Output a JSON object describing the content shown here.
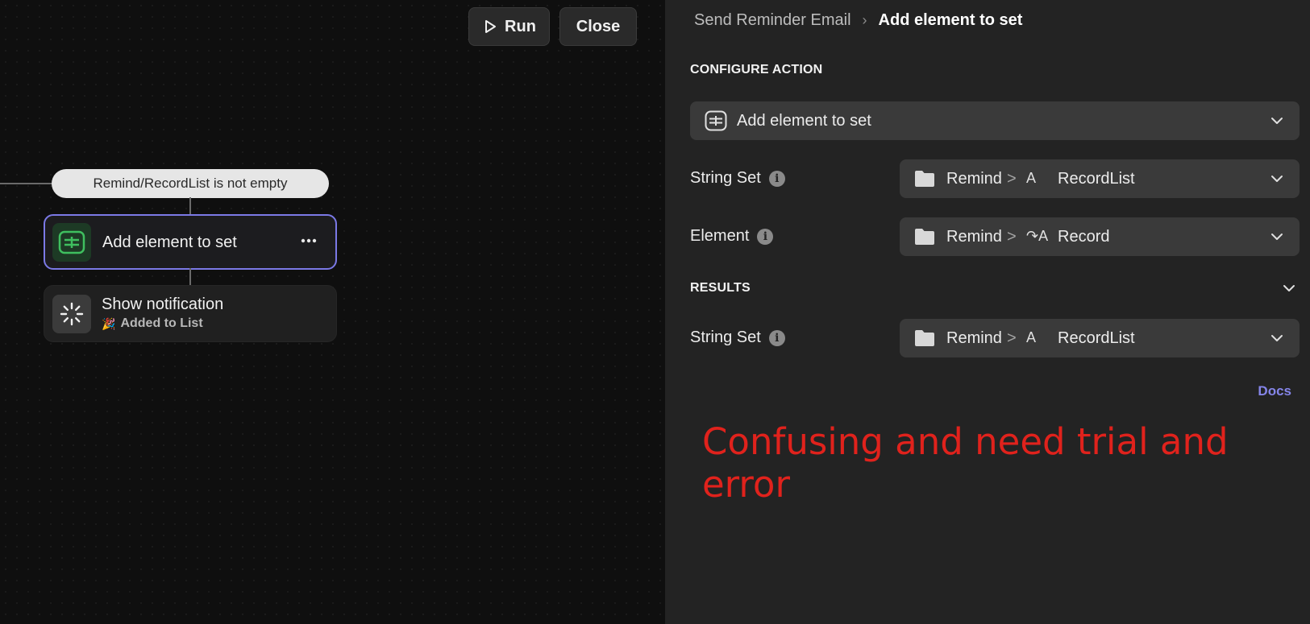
{
  "canvas": {
    "run_label": "Run",
    "close_label": "Close",
    "condition_label": "Remind/RecordList is not empty",
    "nodes": [
      {
        "title": "Add element to set",
        "icon": "set-add-icon"
      },
      {
        "title": "Show notification",
        "subtitle": "Added to List",
        "subtitle_emoji": "🎉",
        "icon": "loading-spinner-icon"
      }
    ]
  },
  "panel": {
    "breadcrumb_parent": "Send Reminder Email",
    "breadcrumb_sep": "›",
    "breadcrumb_current": "Add element to set",
    "configure_title": "CONFIGURE ACTION",
    "action_label": "Add element to set",
    "fields": [
      {
        "label": "String Set",
        "path_group": "Remind",
        "path_sep": ">",
        "type_glyph": "A",
        "path_value": "RecordList"
      },
      {
        "label": "Element",
        "path_group": "Remind",
        "path_sep": ">",
        "type_glyph": "↷A",
        "path_value": "Record"
      }
    ],
    "results_title": "RESULTS",
    "results_fields": [
      {
        "label": "String Set",
        "path_group": "Remind",
        "path_sep": ">",
        "type_glyph": "A",
        "path_value": "RecordList"
      }
    ],
    "docs_label": "Docs"
  },
  "annotation": "Confusing and need trial and error",
  "colors": {
    "accent": "#7b79e6",
    "annotation": "#e0221c",
    "docs": "#8585e9",
    "set_icon_green": "#3fbf5f"
  }
}
